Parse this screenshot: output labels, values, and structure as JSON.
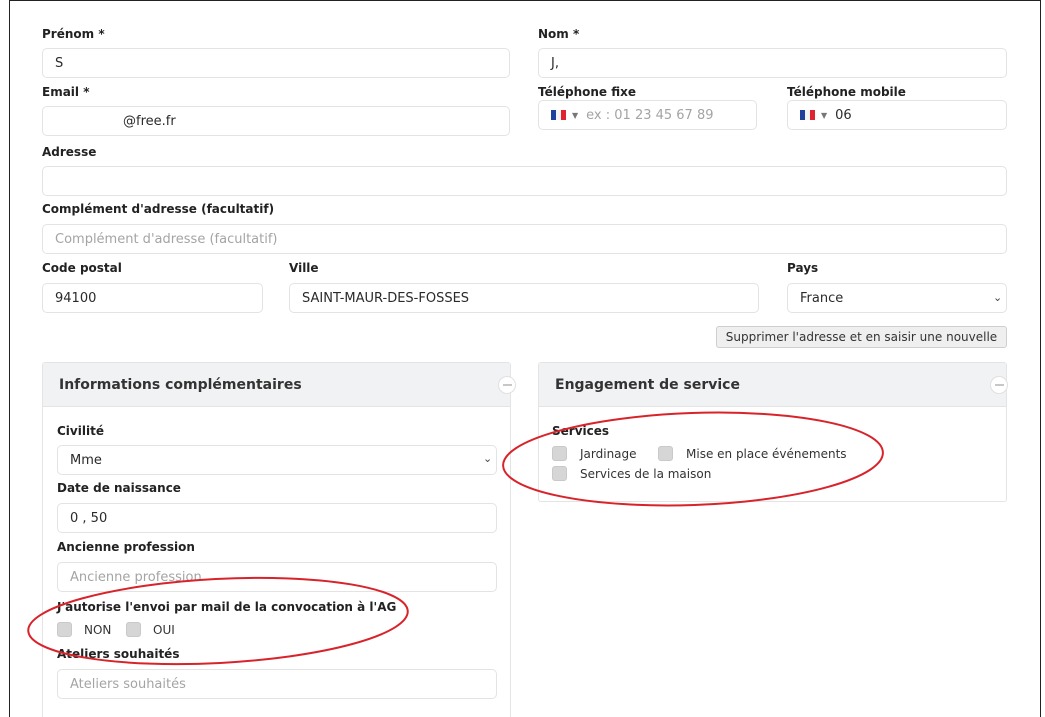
{
  "form": {
    "prenom": {
      "label": "Prénom *",
      "value": "S"
    },
    "nom": {
      "label": "Nom *",
      "value": "J,"
    },
    "email": {
      "label": "Email *",
      "value": "@free.fr"
    },
    "tel_fixe": {
      "label": "Téléphone fixe",
      "placeholder": "ex : 01 23 45 67 89"
    },
    "tel_mobile": {
      "label": "Téléphone mobile",
      "value": "06"
    },
    "adresse": {
      "label": "Adresse",
      "value": ""
    },
    "complement": {
      "label": "Complément d'adresse (facultatif)",
      "placeholder": "Complément d'adresse (facultatif)"
    },
    "code_postal": {
      "label": "Code postal",
      "value": "94100"
    },
    "ville": {
      "label": "Ville",
      "value": "SAINT-MAUR-DES-FOSSES"
    },
    "pays": {
      "label": "Pays",
      "value": "France"
    },
    "reset_address_button": "Supprimer l'adresse et en saisir une nouvelle"
  },
  "info_card": {
    "title": "Informations complémentaires",
    "civilite": {
      "label": "Civilité",
      "value": "Mme"
    },
    "naissance": {
      "label": "Date de naissance",
      "value": "0   ,  50"
    },
    "profession": {
      "label": "Ancienne profession",
      "placeholder": "Ancienne profession"
    },
    "convocation": {
      "label": "J'autorise l'envoi par mail de la convocation à l'AG",
      "options": [
        "NON",
        "OUI"
      ]
    },
    "ateliers": {
      "label": "Ateliers souhaités",
      "placeholder": "Ateliers souhaités"
    }
  },
  "service_card": {
    "title": "Engagement de service",
    "services_label": "Services",
    "options": [
      "Jardinage",
      "Mise en place événements",
      "Services de la maison"
    ]
  },
  "colors": {
    "annotation": "#d8232a",
    "card_header": "#f1f2f4",
    "checkbox": "#d6d6d6"
  }
}
